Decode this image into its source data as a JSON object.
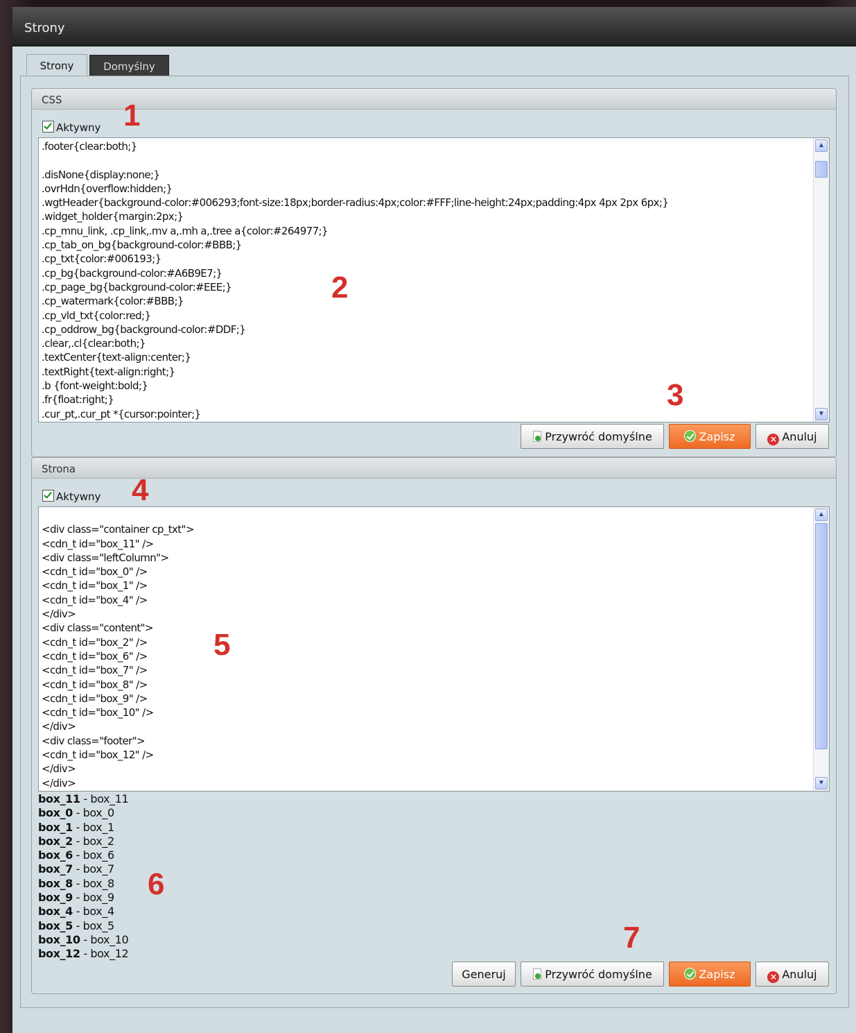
{
  "window": {
    "title": "Strony"
  },
  "tabs": [
    {
      "label": "Strony"
    },
    {
      "label": "Domyślny"
    }
  ],
  "css_section": {
    "header": "CSS",
    "active_label": "Aktywny",
    "content": ".footer{clear:both;}\n\n.disNone{display:none;}\n.ovrHdn{overflow:hidden;}\n.wgtHeader{background-color:#006293;font-size:18px;border-radius:4px;color:#FFF;line-height:24px;padding:4px 4px 2px 6px;}\n.widget_holder{margin:2px;}\n.cp_mnu_link, .cp_link,.mv a,.mh a,.tree a{color:#264977;}\n.cp_tab_on_bg{background-color:#BBB;}\n.cp_txt{color:#006193;}\n.cp_bg{background-color:#A6B9E7;}\n.cp_page_bg{background-color:#EEE;}\n.cp_watermark{color:#BBB;}\n.cp_vld_txt{color:red;}\n.cp_oddrow_bg{background-color:#DDF;}\n.clear,.cl{clear:both;}\n.textCenter{text-align:center;}\n.textRight{text-align:right;}\n.b {font-weight:bold;}\n.fr{float:right;}\n.cur_pt,.cur_pt *{cursor:pointer;}",
    "buttons": {
      "restore": "Przywróć domyślne",
      "save": "Zapisz",
      "cancel": "Anuluj"
    }
  },
  "page_section": {
    "header": "Strona",
    "active_label": "Aktywny",
    "content": "\n<div class=\"container cp_txt\">\n<cdn_t id=\"box_11\" />\n<div class=\"leftColumn\">\n<cdn_t id=\"box_0\" />\n<cdn_t id=\"box_1\" />\n<cdn_t id=\"box_4\" />\n</div>\n<div class=\"content\">\n<cdn_t id=\"box_2\" />\n<cdn_t id=\"box_6\" />\n<cdn_t id=\"box_7\" />\n<cdn_t id=\"box_8\" />\n<cdn_t id=\"box_9\" />\n<cdn_t id=\"box_10\" />\n</div>\n<div class=\"footer\">\n<cdn_t id=\"box_12\" />\n</div>\n</div>",
    "boxes": [
      {
        "key": "box_11",
        "desc": " - box_11"
      },
      {
        "key": "box_0",
        "desc": " - box_0"
      },
      {
        "key": "box_1",
        "desc": " - box_1"
      },
      {
        "key": "box_2",
        "desc": " - box_2"
      },
      {
        "key": "box_6",
        "desc": " - box_6"
      },
      {
        "key": "box_7",
        "desc": " - box_7"
      },
      {
        "key": "box_8",
        "desc": " - box_8"
      },
      {
        "key": "box_9",
        "desc": " - box_9"
      },
      {
        "key": "box_4",
        "desc": " - box_4"
      },
      {
        "key": "box_5",
        "desc": " - box_5"
      },
      {
        "key": "box_10",
        "desc": " - box_10"
      },
      {
        "key": "box_12",
        "desc": " - box_12"
      }
    ],
    "buttons": {
      "generate": "Generuj",
      "restore": "Przywróć domyślne",
      "save": "Zapisz",
      "cancel": "Anuluj"
    }
  },
  "markers": [
    "1",
    "2",
    "3",
    "4",
    "5",
    "6",
    "7"
  ],
  "colors": {
    "accent": "#ee6b24",
    "marker": "#d4302a",
    "background": "#d1dce1"
  }
}
